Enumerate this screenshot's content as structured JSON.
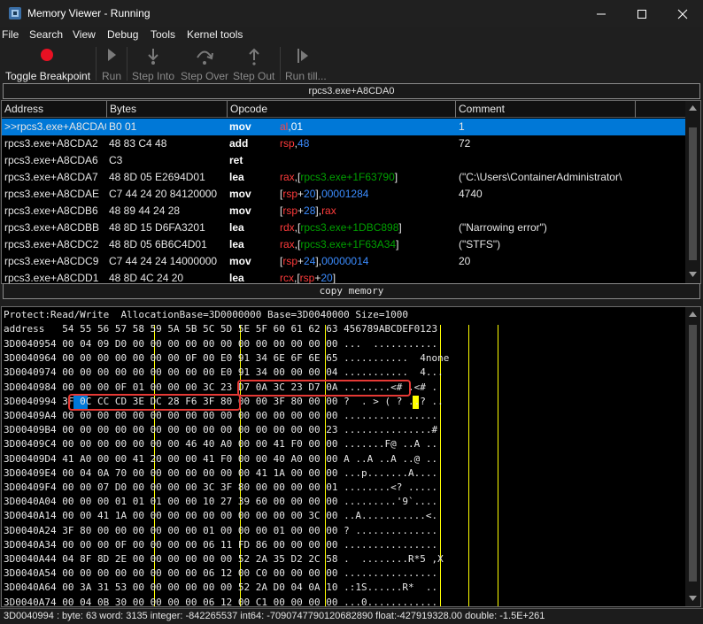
{
  "window": {
    "title": "Memory Viewer - Running",
    "controls": [
      "minimize-icon",
      "maximize-icon",
      "close-icon"
    ]
  },
  "menu": [
    "File",
    "Search",
    "View",
    "Debug",
    "Tools",
    "Kernel tools"
  ],
  "toolbar": {
    "toggle_breakpoint": "Toggle Breakpoint",
    "run": "Run",
    "step_into": "Step Into",
    "step_over": "Step Over",
    "step_out": "Step Out",
    "run_till": "Run till...",
    "breakpoint_color": "#e81123"
  },
  "disassembler": {
    "title": "rpcs3.exe+A8CDA0",
    "columns": [
      "Address",
      "Bytes",
      "Opcode",
      "Comment"
    ],
    "rows": [
      {
        "addr": ">>rpcs3.exe+A8CDA0",
        "bytes": "B0 01",
        "op": "mov",
        "args": [
          [
            "al",
            "r"
          ],
          [
            ",",
            "w"
          ],
          [
            "01",
            "b"
          ]
        ],
        "comment": "1"
      },
      {
        "addr": "rpcs3.exe+A8CDA2",
        "bytes": "48 83 C4 48",
        "op": "add",
        "args": [
          [
            "rsp",
            "r"
          ],
          [
            ",",
            "w"
          ],
          [
            "48",
            "b"
          ]
        ],
        "comment": "72"
      },
      {
        "addr": "rpcs3.exe+A8CDA6",
        "bytes": "C3",
        "op": "ret",
        "args": [],
        "comment": ""
      },
      {
        "addr": "rpcs3.exe+A8CDA7",
        "bytes": "48 8D 05 E2694D01",
        "op": "lea",
        "args": [
          [
            "rax",
            "r"
          ],
          [
            ",[",
            "w"
          ],
          [
            "rpcs3.exe+1F63790",
            "g"
          ],
          [
            "]",
            "w"
          ]
        ],
        "comment": "(\"C:\\Users\\ContainerAdministrator\\"
      },
      {
        "addr": "rpcs3.exe+A8CDAE",
        "bytes": "C7 44 24 20 84120000",
        "op": "mov",
        "args": [
          [
            "[",
            "w"
          ],
          [
            "rsp",
            "r"
          ],
          [
            "+",
            "w"
          ],
          [
            "20",
            "b"
          ],
          [
            "],",
            "w"
          ],
          [
            "00001284",
            "b"
          ]
        ],
        "comment": "4740"
      },
      {
        "addr": "rpcs3.exe+A8CDB6",
        "bytes": "48 89 44 24 28",
        "op": "mov",
        "args": [
          [
            "[",
            "w"
          ],
          [
            "rsp",
            "r"
          ],
          [
            "+",
            "w"
          ],
          [
            "28",
            "b"
          ],
          [
            "],",
            "w"
          ],
          [
            "rax",
            "r"
          ]
        ],
        "comment": ""
      },
      {
        "addr": "rpcs3.exe+A8CDBB",
        "bytes": "48 8D 15 D6FA3201",
        "op": "lea",
        "args": [
          [
            "rdx",
            "r"
          ],
          [
            ",[",
            "w"
          ],
          [
            "rpcs3.exe+1DBC898",
            "g"
          ],
          [
            "]",
            "w"
          ]
        ],
        "comment": "(\"Narrowing error\")"
      },
      {
        "addr": "rpcs3.exe+A8CDC2",
        "bytes": "48 8D 05 6B6C4D01",
        "op": "lea",
        "args": [
          [
            "rax",
            "r"
          ],
          [
            ",[",
            "w"
          ],
          [
            "rpcs3.exe+1F63A34",
            "g"
          ],
          [
            "]",
            "w"
          ]
        ],
        "comment": "(\"STFS\")"
      },
      {
        "addr": "rpcs3.exe+A8CDC9",
        "bytes": "C7 44 24 24 14000000",
        "op": "mov",
        "args": [
          [
            "[",
            "w"
          ],
          [
            "rsp",
            "r"
          ],
          [
            "+",
            "w"
          ],
          [
            "24",
            "b"
          ],
          [
            "],",
            "w"
          ],
          [
            "00000014",
            "b"
          ]
        ],
        "comment": "20"
      },
      {
        "addr": "rpcs3.exe+A8CDD1",
        "bytes": "48 8D 4C 24 20",
        "op": "lea",
        "args": [
          [
            "rcx",
            "r"
          ],
          [
            ",[",
            "w"
          ],
          [
            "rsp",
            "r"
          ],
          [
            "+",
            "w"
          ],
          [
            "20",
            "b"
          ],
          [
            "]",
            "w"
          ]
        ],
        "comment": ""
      }
    ]
  },
  "copy_memory_label": "copy memory",
  "splitter_glyph": "......",
  "hexview": {
    "info": "Protect:Read/Write  AllocationBase=3D0000000 Base=3D0040000 Size=1000",
    "header": "address   54 55 56 57 58 59 5A 5B 5C 5D 5E 5F 60 61 62 63 456789ABCDEF0123",
    "lines": [
      "3D0040954 00 04 09 D0 00 00 00 00 00 00 00 00 00 00 00 00 ...  ...........",
      "3D0040964 00 00 00 00 00 00 00 0F 00 E0 91 34 6E 6F 6E 65 ...........  4none",
      "3D0040974 00 00 00 00 00 00 00 00 00 E0 91 34 00 00 00 04 ...........  4...",
      "3D0040984 00 00 00 0F 01 00 00 00 3C 23 D7 0A 3C 23 D7 0A ........<# .<# .",
      "3D0040994 3F 0C CC CD 3E DC 28 F6 3F 80 00 00 3F 80 00 00 ?  . > ( ? ..? ..",
      "3D00409A4 00 00 00 00 00 00 00 00 00 00 00 00 00 00 00 00 ................",
      "3D00409B4 00 00 00 00 00 00 00 00 00 00 00 00 00 00 00 23 ...............#",
      "3D00409C4 00 00 00 00 00 00 00 46 40 A0 00 00 41 F0 00 00 .......F@ ..A ..",
      "3D00409D4 41 A0 00 00 41 20 00 00 41 F0 00 00 40 A0 00 00 A ..A ..A ..@ ..",
      "3D00409E4 00 04 0A 70 00 00 00 00 00 00 00 41 1A 00 00 00 ...p.......A....",
      "3D00409F4 00 00 07 D0 00 00 00 00 3C 3F 80 00 00 00 00 01 ........<? .....",
      "3D0040A04 00 00 00 01 01 01 00 00 10 27 39 60 00 00 00 00 .........'9`....",
      "3D0040A14 00 00 41 1A 00 00 00 00 00 00 00 00 00 00 3C 00 ..A...........<.",
      "3D0040A24 3F 80 00 00 00 00 00 00 01 00 00 00 01 00 00 00 ? ..............",
      "3D0040A34 00 00 00 0F 00 00 00 00 06 11 FD 86 00 00 00 00 ................",
      "3D0040A44 04 8F 8D 2E 00 00 00 00 00 00 52 2A 35 D2 2C 58 .  ........R*5 ,X",
      "3D0040A54 00 00 00 00 00 00 00 00 06 12 00 C0 00 00 00 00 ................",
      "3D0040A64 00 3A 31 53 00 00 00 00 00 00 52 2A D0 04 0A 10 .:1S......R*  ..",
      "3D0040A74 00 04 0B 30 00 00 00 00 06 12 00 C1 00 00 00 00 ...0............"
    ]
  },
  "status": "3D0040994 : byte: 63 word: 3135 integer: -842265537 int64: -7090747790120682890 float:-427919328.00 double: -1.5E+261",
  "colors": {
    "selection": "#0078d7",
    "register": "#ff3b3b",
    "number": "#3b8cff",
    "symbol": "#00a000",
    "column_marker": "#ffff00",
    "annotation_box": "#e53935"
  }
}
